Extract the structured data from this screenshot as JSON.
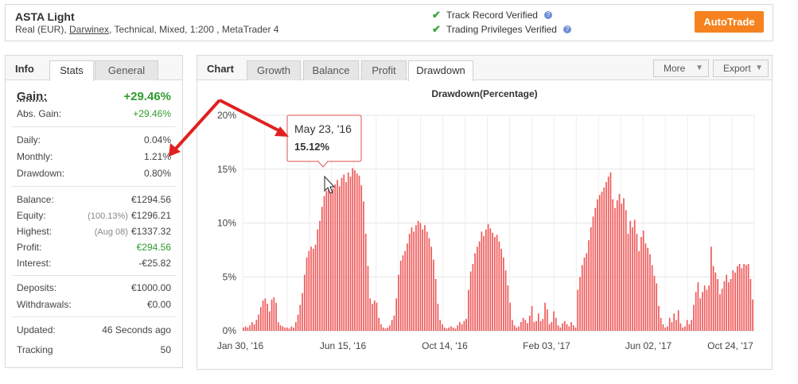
{
  "account": {
    "name": "ASTA Light",
    "desc_prefix": "Real (EUR), ",
    "broker": "Darwinex",
    "desc_suffix": ", Technical, Mixed, 1:200 , MetaTrader 4"
  },
  "verification": {
    "track_record": "Track Record Verified",
    "trading_privileges": "Trading Privileges Verified",
    "help_glyph": "?"
  },
  "autotrade_label": "AutoTrade",
  "info": {
    "title": "Info",
    "tabs": [
      "Stats",
      "General"
    ],
    "gain_label": "Gain:",
    "gain_value": "+29.46%",
    "abs_gain_label": "Abs. Gain:",
    "abs_gain_value": "+29.46%",
    "daily_label": "Daily:",
    "daily_value": "0.04%",
    "monthly_label": "Monthly:",
    "monthly_value": "1.21%",
    "drawdown_label": "Drawdown:",
    "drawdown_value": "0.80%",
    "balance_label": "Balance:",
    "balance_value": "€1294.56",
    "equity_label": "Equity:",
    "equity_sub": "(100.13%)",
    "equity_value": "€1296.21",
    "highest_label": "Highest:",
    "highest_sub": "(Aug 08)",
    "highest_value": "€1337.32",
    "profit_label": "Profit:",
    "profit_value": "€294.56",
    "interest_label": "Interest:",
    "interest_value": "-€25.82",
    "deposits_label": "Deposits:",
    "deposits_value": "€1000.00",
    "withdrawals_label": "Withdrawals:",
    "withdrawals_value": "€0.00",
    "updated_label": "Updated:",
    "updated_value": "46 Seconds ago",
    "tracking_label": "Tracking",
    "tracking_value": "50"
  },
  "chart_panel": {
    "title": "Chart",
    "tabs": [
      "Growth",
      "Balance",
      "Profit",
      "Drawdown"
    ],
    "active_tab": "Drawdown",
    "more_label": "More",
    "export_label": "Export",
    "caret": "▼"
  },
  "colors": {
    "bar": "#f05a5a",
    "accent": "#f5821f",
    "positive": "#2e9c2e",
    "arrow": "#e02020"
  },
  "tooltip": {
    "date": "May 23, '16",
    "value": "15.12%"
  },
  "chart_data": {
    "type": "bar",
    "title": "Drawdown(Percentage)",
    "xlabel": "",
    "ylabel": "",
    "ylim": [
      0,
      20
    ],
    "y_ticks": [
      "0%",
      "5%",
      "10%",
      "15%",
      "20%"
    ],
    "x_ticks": [
      "Jan 30, '16",
      "Jun 15, '16",
      "Oct 14, '16",
      "Feb 03, '17",
      "Jun 02, '17",
      "Oct 24, '17"
    ],
    "grid": true,
    "series": [
      {
        "values": [
          0.3,
          0.4,
          0.3,
          0.5,
          0.8,
          0.6,
          1.0,
          1.5,
          2.2,
          2.8,
          3.0,
          2.5,
          1.8,
          2.9,
          3.1,
          2.6,
          0.8,
          0.5,
          0.4,
          0.3,
          0.3,
          0.2,
          0.4,
          0.3,
          0.8,
          1.5,
          2.4,
          3.5,
          5.2,
          6.8,
          7.4,
          7.8,
          7.6,
          8.0,
          9.4,
          10.2,
          11.5,
          12.5,
          13.0,
          13.5,
          12.8,
          13.2,
          13.6,
          14.0,
          13.4,
          14.2,
          14.5,
          13.8,
          14.7,
          14.3,
          15.1,
          14.9,
          14.6,
          14.4,
          13.5,
          12.0,
          9.0,
          6.0,
          3.0,
          2.5,
          2.8,
          2.6,
          1.2,
          0.6,
          0.3,
          0.2,
          0.3,
          0.5,
          1.0,
          1.4,
          3.0,
          5.2,
          6.5,
          7.0,
          7.4,
          8.1,
          9.0,
          9.6,
          9.2,
          9.8,
          10.2,
          10.0,
          9.4,
          9.8,
          9.2,
          8.6,
          7.8,
          6.6,
          4.8,
          2.5,
          1.0,
          0.6,
          0.3,
          0.2,
          0.3,
          0.4,
          0.3,
          0.2,
          0.5,
          0.8,
          0.6,
          0.9,
          1.1,
          3.8,
          5.5,
          6.2,
          7.2,
          7.8,
          8.3,
          9.2,
          8.8,
          9.4,
          9.9,
          9.5,
          9.1,
          8.7,
          8.9,
          8.3,
          7.6,
          6.8,
          5.6,
          4.2,
          2.6,
          1.0,
          0.5,
          0.3,
          0.4,
          0.8,
          1.2,
          1.0,
          0.7,
          1.4,
          2.3,
          0.8,
          0.9,
          1.6,
          0.9,
          1.1,
          2.6,
          2.0,
          0.6,
          0.8,
          1.8,
          1.2,
          0.5,
          0.3,
          0.7,
          0.9,
          0.6,
          0.4,
          0.8,
          0.5,
          0.3,
          3.8,
          5.0,
          6.1,
          6.8,
          7.2,
          8.4,
          9.6,
          10.6,
          11.4,
          12.2,
          12.6,
          12.9,
          13.3,
          13.8,
          14.3,
          14.7,
          12.2,
          11.4,
          12.1,
          12.7,
          11.8,
          12.3,
          11.2,
          9.0,
          10.2,
          9.6,
          10.3,
          9.0,
          7.4,
          8.7,
          9.3,
          8.1,
          7.7,
          7.1,
          6.1,
          5.1,
          4.4,
          2.3,
          1.2,
          0.6,
          0.3,
          0.4,
          1.2,
          0.8,
          1.6,
          1.0,
          1.9,
          0.7,
          0.3,
          0.4,
          1.0,
          0.6,
          1.0,
          2.4,
          3.6,
          4.5,
          3.0,
          3.6,
          4.2,
          3.8,
          4.2,
          7.8,
          6.0,
          5.4,
          4.8,
          3.4,
          3.9,
          4.6,
          5.2,
          4.5,
          4.8,
          5.6,
          5.4,
          6.0,
          6.2,
          5.8,
          6.2,
          6.1,
          6.2,
          4.8,
          2.9
        ]
      }
    ]
  }
}
